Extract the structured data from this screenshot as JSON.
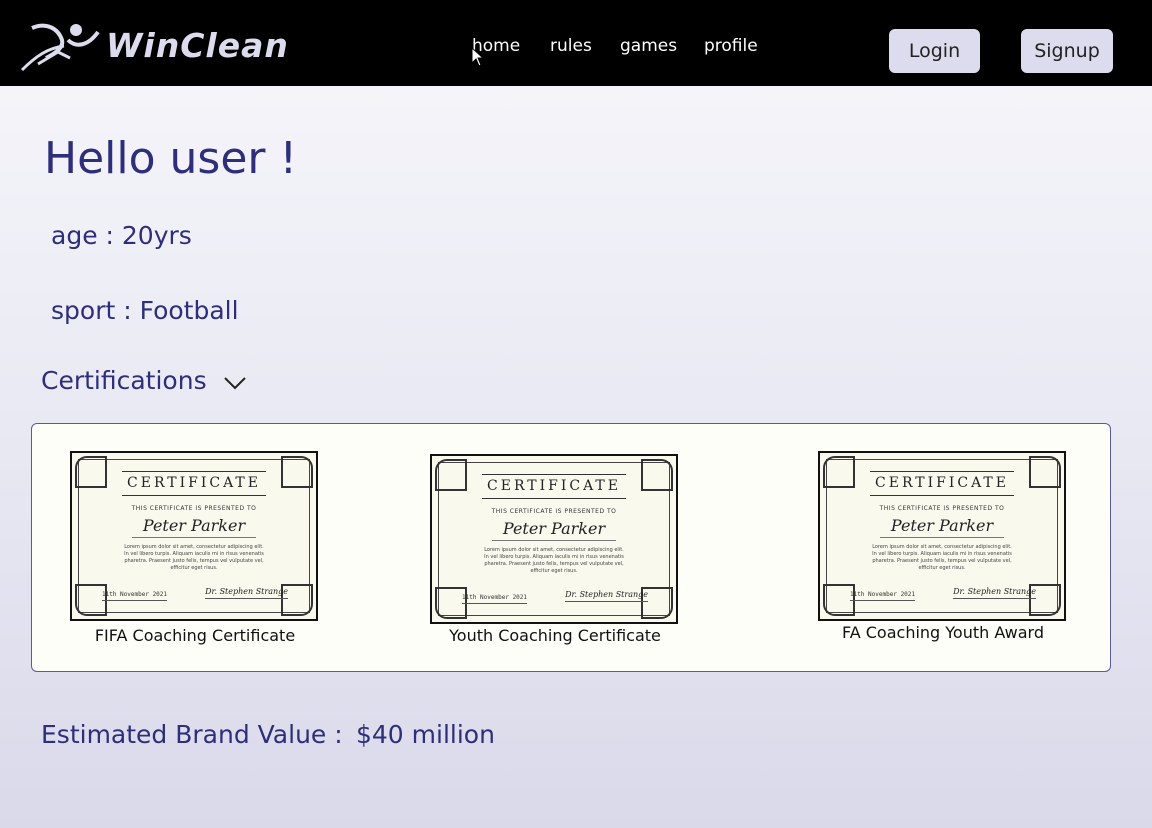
{
  "nav": {
    "logo_text": "WinClean",
    "links": [
      "home",
      "rules",
      "games",
      "profile"
    ],
    "login_label": "Login",
    "signup_label": "Signup"
  },
  "profile": {
    "greeting": "Hello user !",
    "age": "age : 20yrs",
    "sport": "sport : Football"
  },
  "certifications": {
    "header": "Certifications",
    "items": [
      {
        "caption": "FIFA Coaching Certificate",
        "heading": "CERTIFICATE",
        "subheading": "THIS CERTIFICATE IS PRESENTED TO",
        "recipient": "Peter Parker",
        "body": "Lorem ipsum dolor sit amet, consectetur adipiscing elit. In vel libero turpis. Aliquam iaculis mi in risus venenatis pharetra. Praesent justo felis, tempus vel vulputate vel, efficitur eget risus.",
        "date": "11th November 2021",
        "signature": "Dr. Stephen Strange"
      },
      {
        "caption": "Youth Coaching Certificate",
        "heading": "CERTIFICATE",
        "subheading": "THIS CERTIFICATE IS PRESENTED TO",
        "recipient": "Peter Parker",
        "body": "Lorem ipsum dolor sit amet, consectetur adipiscing elit. In vel libero turpis. Aliquam iaculis mi in risus venenatis pharetra. Praesent justo felis, tempus vel vulputate vel, efficitur eget risus.",
        "date": "11th November 2021",
        "signature": "Dr. Stephen Strange"
      },
      {
        "caption": "FA Coaching Youth Award",
        "heading": "CERTIFICATE",
        "subheading": "THIS CERTIFICATE IS PRESENTED TO",
        "recipient": "Peter Parker",
        "body": "Lorem ipsum dolor sit amet, consectetur adipiscing elit. In vel libero turpis. Aliquam iaculis mi in risus venenatis pharetra. Praesent justo felis, tempus vel vulputate vel, efficitur eget risus.",
        "date": "11th November 2021",
        "signature": "Dr. Stephen Strange"
      }
    ]
  },
  "brand": {
    "label": "Estimated Brand Value :",
    "value": "$40 million"
  },
  "colors": {
    "topbar": "#000000",
    "accent_text": "#2e2e7a",
    "button_bg": "#dcdcee"
  }
}
